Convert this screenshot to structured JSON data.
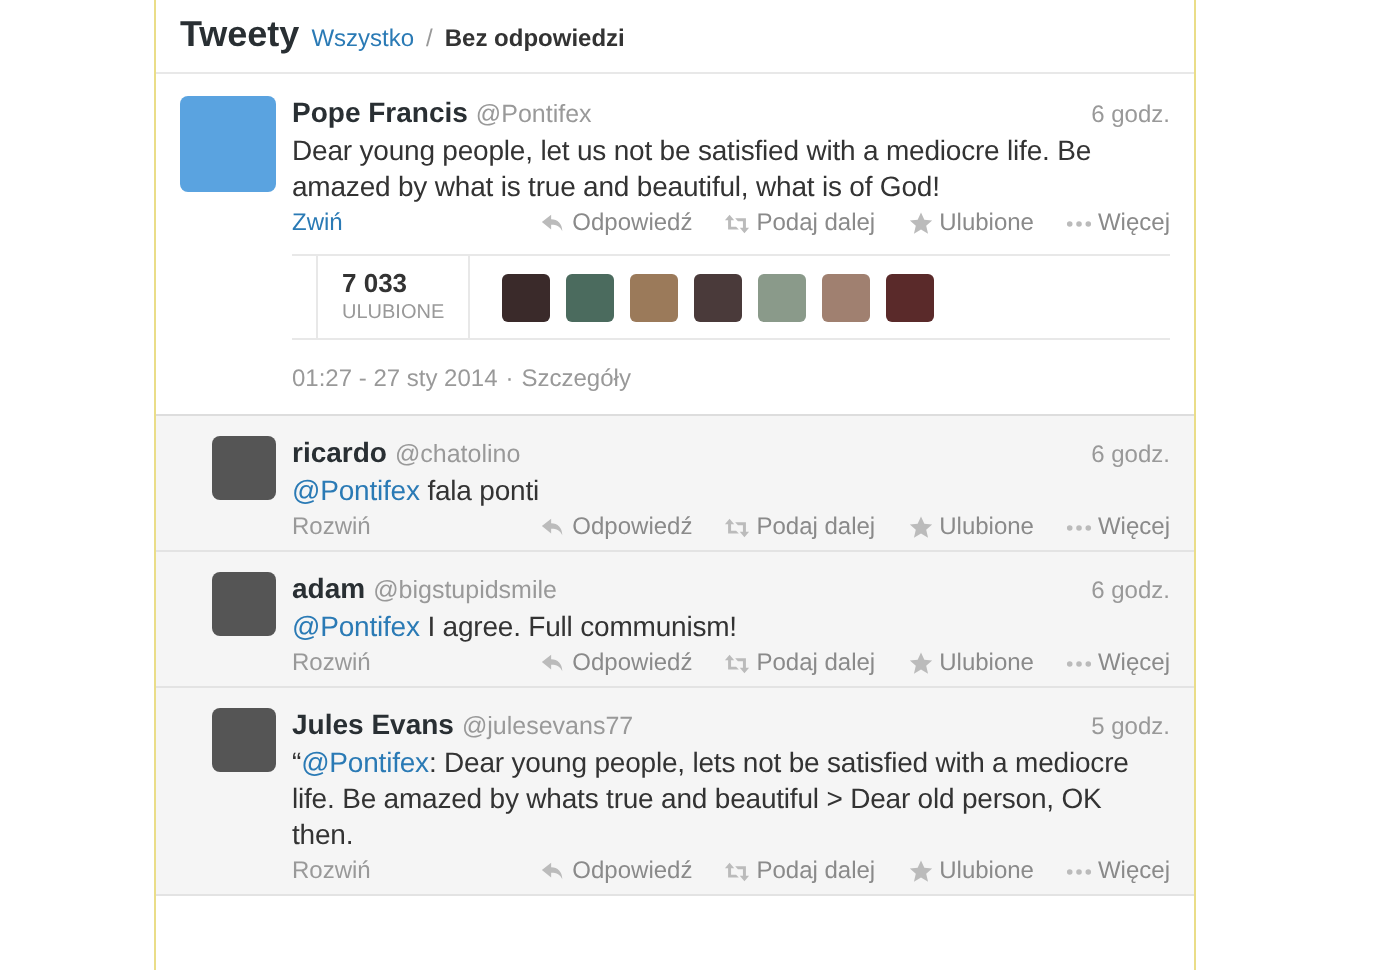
{
  "header": {
    "title": "Tweety",
    "separator": "/",
    "filters": [
      {
        "label": "Wszystko",
        "selected": false
      },
      {
        "label": "Bez odpowiedzi",
        "selected": true
      }
    ]
  },
  "main_tweet": {
    "name": "Pope Francis",
    "handle": "@Pontifex",
    "time": "6 godz.",
    "parts": [
      {
        "kind": "text",
        "text": "Dear young people, let us not be satisfied with a mediocre life. Be amazed by what is true and beautiful, what is of God!"
      }
    ],
    "toggle": {
      "label": "Zwiń",
      "expanded": true
    },
    "actions": [
      "Odpowiedź",
      "Podaj dalej",
      "Ulubione",
      "Więcej"
    ],
    "stats": {
      "count": "7 033",
      "label": "ULUBIONE"
    },
    "timestamp": "01:27 - 27 sty 2014",
    "meta_separator": "·",
    "details_link": "Szczegóły"
  },
  "replies": [
    {
      "name": "ricardo",
      "handle": "@chatolino",
      "time": "6 godz.",
      "parts": [
        {
          "kind": "mention",
          "text": "@Pontifex"
        },
        {
          "kind": "text",
          "text": " fala ponti"
        }
      ],
      "toggle": {
        "label": "Rozwiń",
        "expanded": false
      },
      "actions": [
        "Odpowiedź",
        "Podaj dalej",
        "Ulubione",
        "Więcej"
      ]
    },
    {
      "name": "adam",
      "handle": "@bigstupidsmile",
      "time": "6 godz.",
      "parts": [
        {
          "kind": "mention",
          "text": "@Pontifex"
        },
        {
          "kind": "text",
          "text": " I agree. Full communism!"
        }
      ],
      "toggle": {
        "label": "Rozwiń",
        "expanded": false
      },
      "actions": [
        "Odpowiedź",
        "Podaj dalej",
        "Ulubione",
        "Więcej"
      ]
    },
    {
      "name": "Jules Evans",
      "handle": "@julesevans77",
      "time": "5 godz.",
      "parts": [
        {
          "kind": "text",
          "text": "“"
        },
        {
          "kind": "mention",
          "text": "@Pontifex"
        },
        {
          "kind": "text",
          "text": ": Dear young people, lets not be satisfied with a mediocre life. Be amazed by whats true and beautiful > Dear old person, OK then."
        }
      ],
      "toggle": {
        "label": "Rozwiń",
        "expanded": false
      },
      "actions": [
        "Odpowiedź",
        "Podaj dalej",
        "Ulubione",
        "Więcej"
      ]
    }
  ]
}
